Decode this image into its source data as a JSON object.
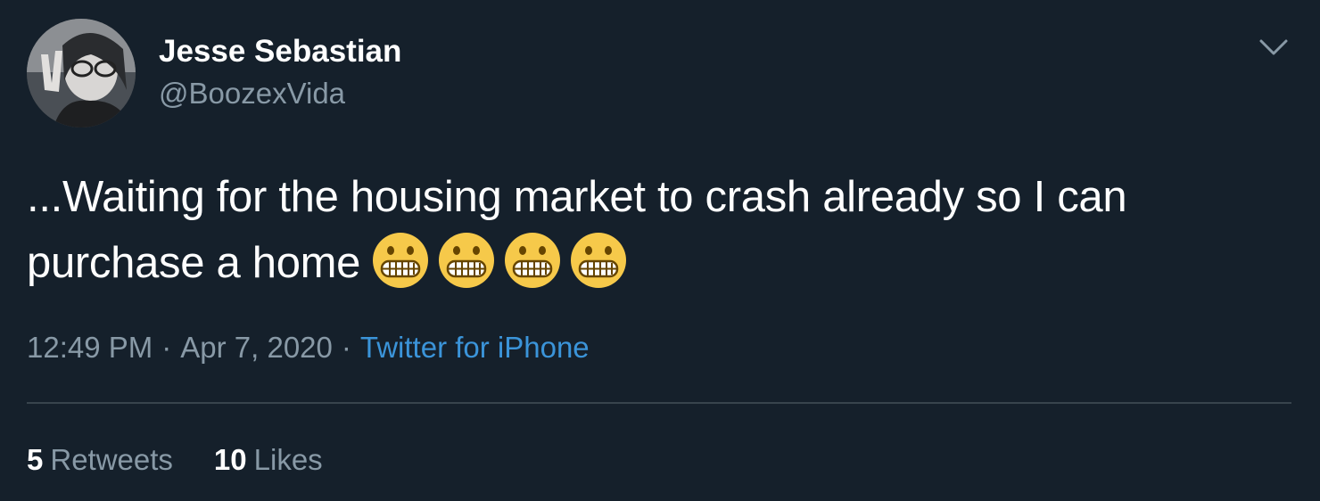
{
  "tweet": {
    "author": {
      "name": "Jesse Sebastian",
      "handle": "@BoozexVida"
    },
    "menu_icon": "chevron-down-icon",
    "text": {
      "line1": "...Waiting for the housing market to crash already so I can",
      "line2": "purchase a home",
      "emoji": [
        "grimacing-face",
        "grimacing-face",
        "grimacing-face",
        "grimacing-face"
      ]
    },
    "meta": {
      "time": "12:49 PM",
      "separator": "·",
      "date": "Apr 7, 2020",
      "source": "Twitter for iPhone"
    },
    "stats": {
      "retweets_count": "5",
      "retweets_label": "Retweets",
      "likes_count": "10",
      "likes_label": "Likes"
    }
  },
  "colors": {
    "background": "#15202b",
    "text_primary": "#ffffff",
    "text_secondary": "#8899a6",
    "link": "#3b94d9",
    "divider": "#38444d"
  }
}
